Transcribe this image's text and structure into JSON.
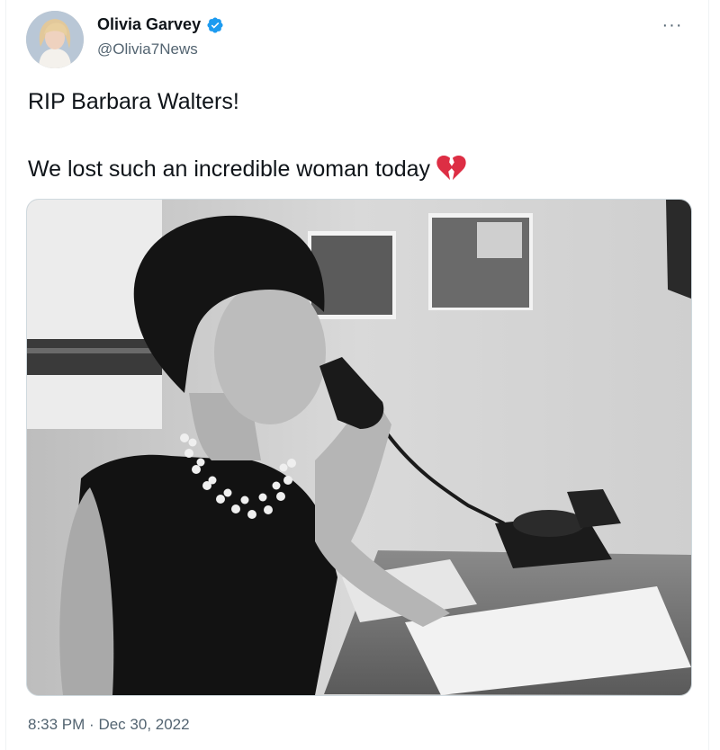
{
  "author": {
    "display_name": "Olivia Garvey",
    "handle": "@Olivia7News",
    "verified": true,
    "verified_icon": "verified-badge-icon",
    "accent_color": "#1d9bf0"
  },
  "tweet": {
    "line1": "RIP Barbara Walters!",
    "line2": "We lost such an incredible woman today",
    "emoji": "broken-heart-icon"
  },
  "media": {
    "kind": "black-and-white photo"
  },
  "meta": {
    "time": "8:33 PM",
    "separator": "·",
    "date": "Dec 30, 2022"
  },
  "menu": {
    "icon": "more-options-icon",
    "glyph": "···"
  }
}
